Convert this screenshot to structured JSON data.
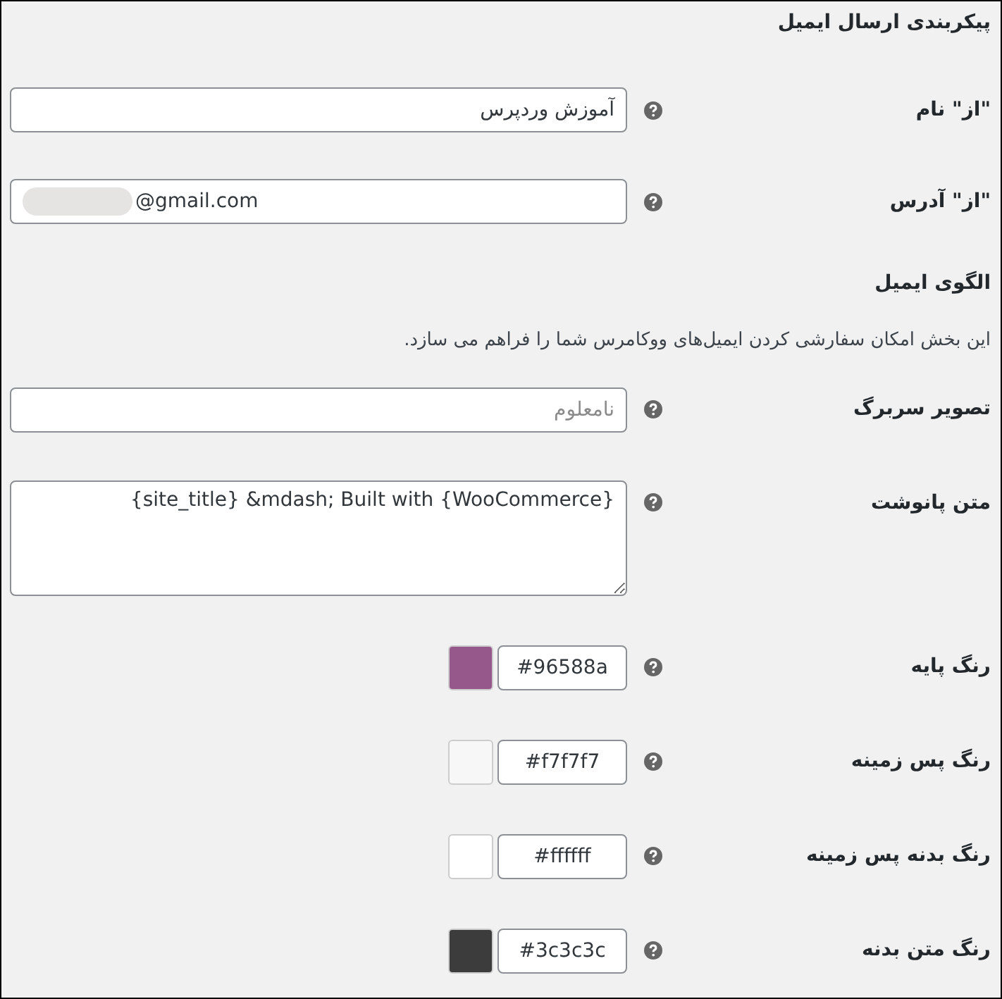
{
  "section_title": "پیکربندی ارسال ایمیل",
  "sender_fields": [
    {
      "kind": "text",
      "label": "\"از\" نام",
      "value": "آموزش وردپرس"
    },
    {
      "kind": "email",
      "label": "\"از\" آدرس",
      "value": "@gmail.com",
      "redacted": true
    }
  ],
  "template_title": "الگوی ایمیل",
  "template_description": "این بخش امکان سفارشی کردن ایمیل‌های ووکامرس شما را فراهم می سازد.",
  "template_fields": [
    {
      "kind": "text",
      "label": "تصویر سربرگ",
      "placeholder": "نامعلوم"
    },
    {
      "kind": "textarea",
      "label": "متن پانوشت",
      "value": "{site_title} &mdash; Built with {WooCommerce}"
    }
  ],
  "colors": [
    {
      "label": "رنگ پایه",
      "value": "#96588a",
      "color": "#96588a"
    },
    {
      "label": "رنگ پس زمینه",
      "value": "#f7f7f7",
      "color": "#f7f7f7"
    },
    {
      "label": "رنگ بدنه پس زمینه",
      "value": "#ffffff",
      "color": "#ffffff"
    },
    {
      "label": "رنگ متن بدنه",
      "value": "#3c3c3c",
      "color": "#3c3c3c"
    }
  ]
}
